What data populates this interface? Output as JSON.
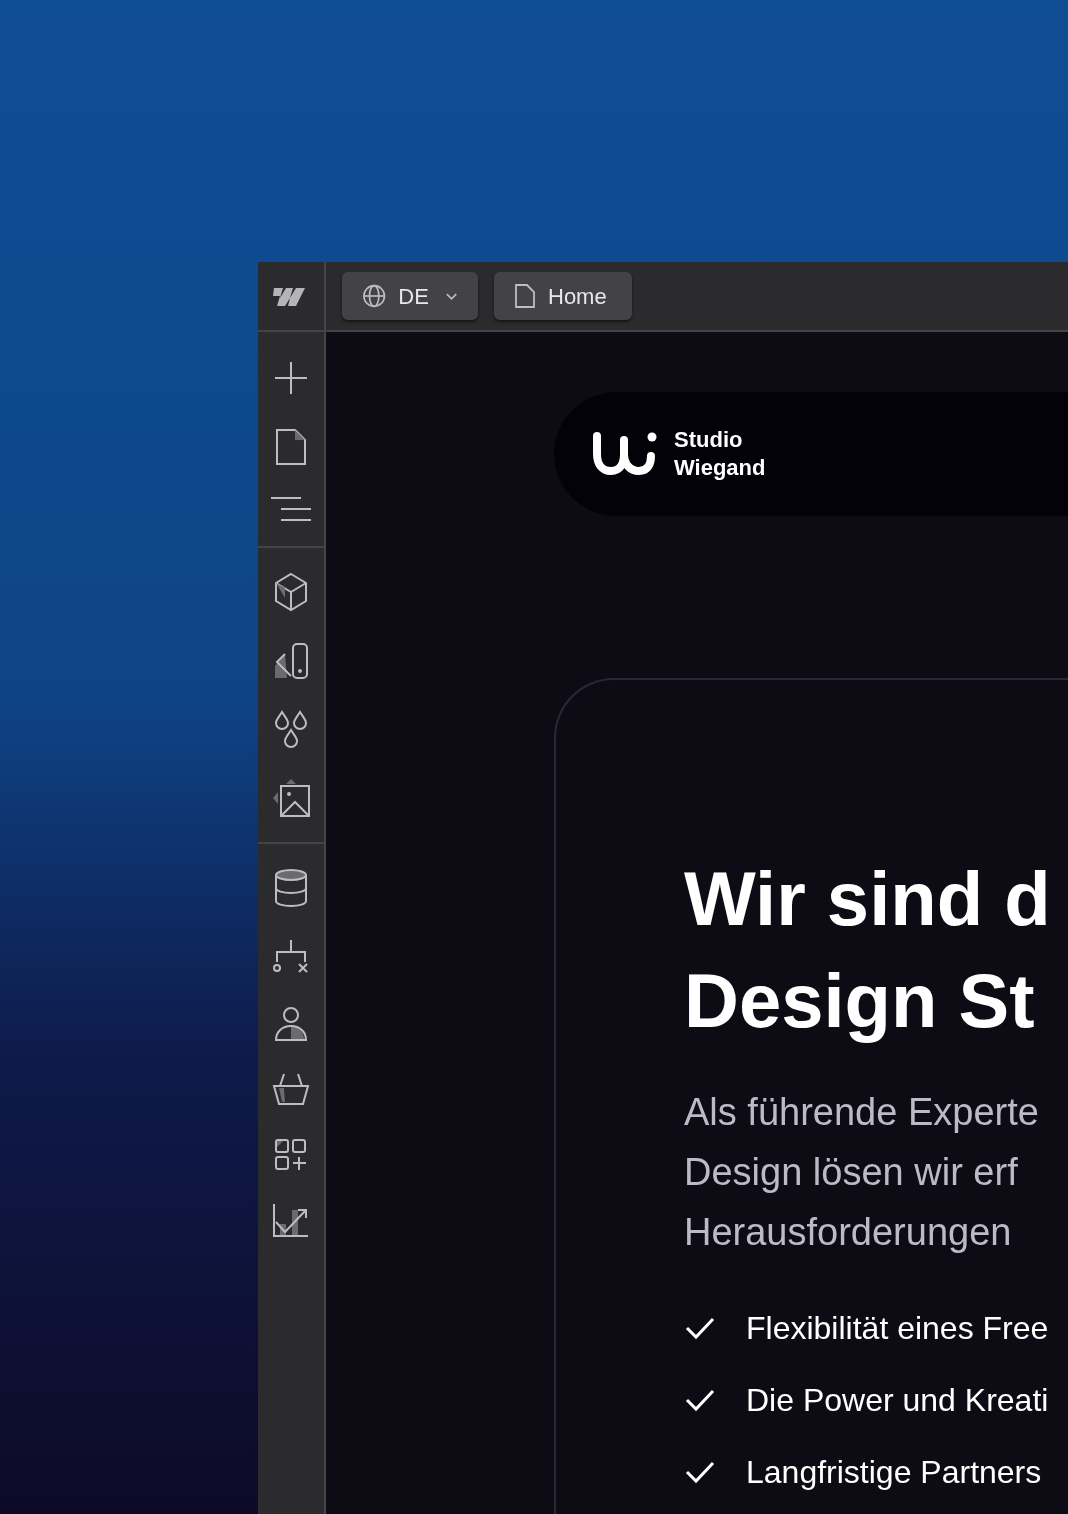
{
  "toolbar": {
    "locale": {
      "label": "DE"
    },
    "page": {
      "label": "Home"
    }
  },
  "canvas": {
    "navbar": {
      "brand_lines": [
        "Studio",
        "Wiegand"
      ]
    },
    "hero": {
      "heading_lines": [
        "Wir sind d",
        "Design St"
      ],
      "paragraph_lines": [
        "Als führende Experte",
        "Design lösen wir erf",
        "Herausforderungen"
      ],
      "features": [
        "Flexibilität eines Free",
        "Die Power und Kreati",
        "Langfristige Partners"
      ]
    }
  }
}
